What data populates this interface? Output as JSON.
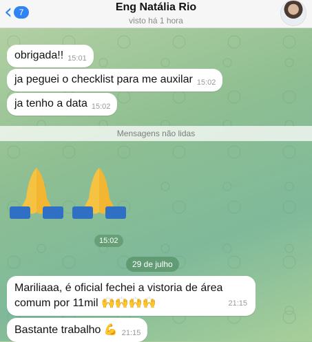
{
  "header": {
    "back_count": "7",
    "title": "Eng Natália Rio",
    "subtitle": "visto há 1 hora"
  },
  "messages_top": [
    {
      "text": "obrigada!!",
      "time": "15:01"
    },
    {
      "text": "ja peguei o checklist para me auxilar",
      "time": "15:02"
    },
    {
      "text": "ja tenho a data",
      "time": "15:02"
    }
  ],
  "unread_label": "Mensagens não lidas",
  "sticker": {
    "emoji": "🙏",
    "time": "15:02"
  },
  "date_divider": "29 de julho",
  "messages_bottom": [
    {
      "text": "Mariliaaa, é oficial fechei a vistoria de área comum por 11mil 🙌🙌🙌🙌",
      "time": "21:15"
    },
    {
      "text": "Bastante trabalho 💪",
      "time": "21:15"
    }
  ],
  "colors": {
    "accent": "#2f83f2",
    "bubble": "#ffffff"
  }
}
